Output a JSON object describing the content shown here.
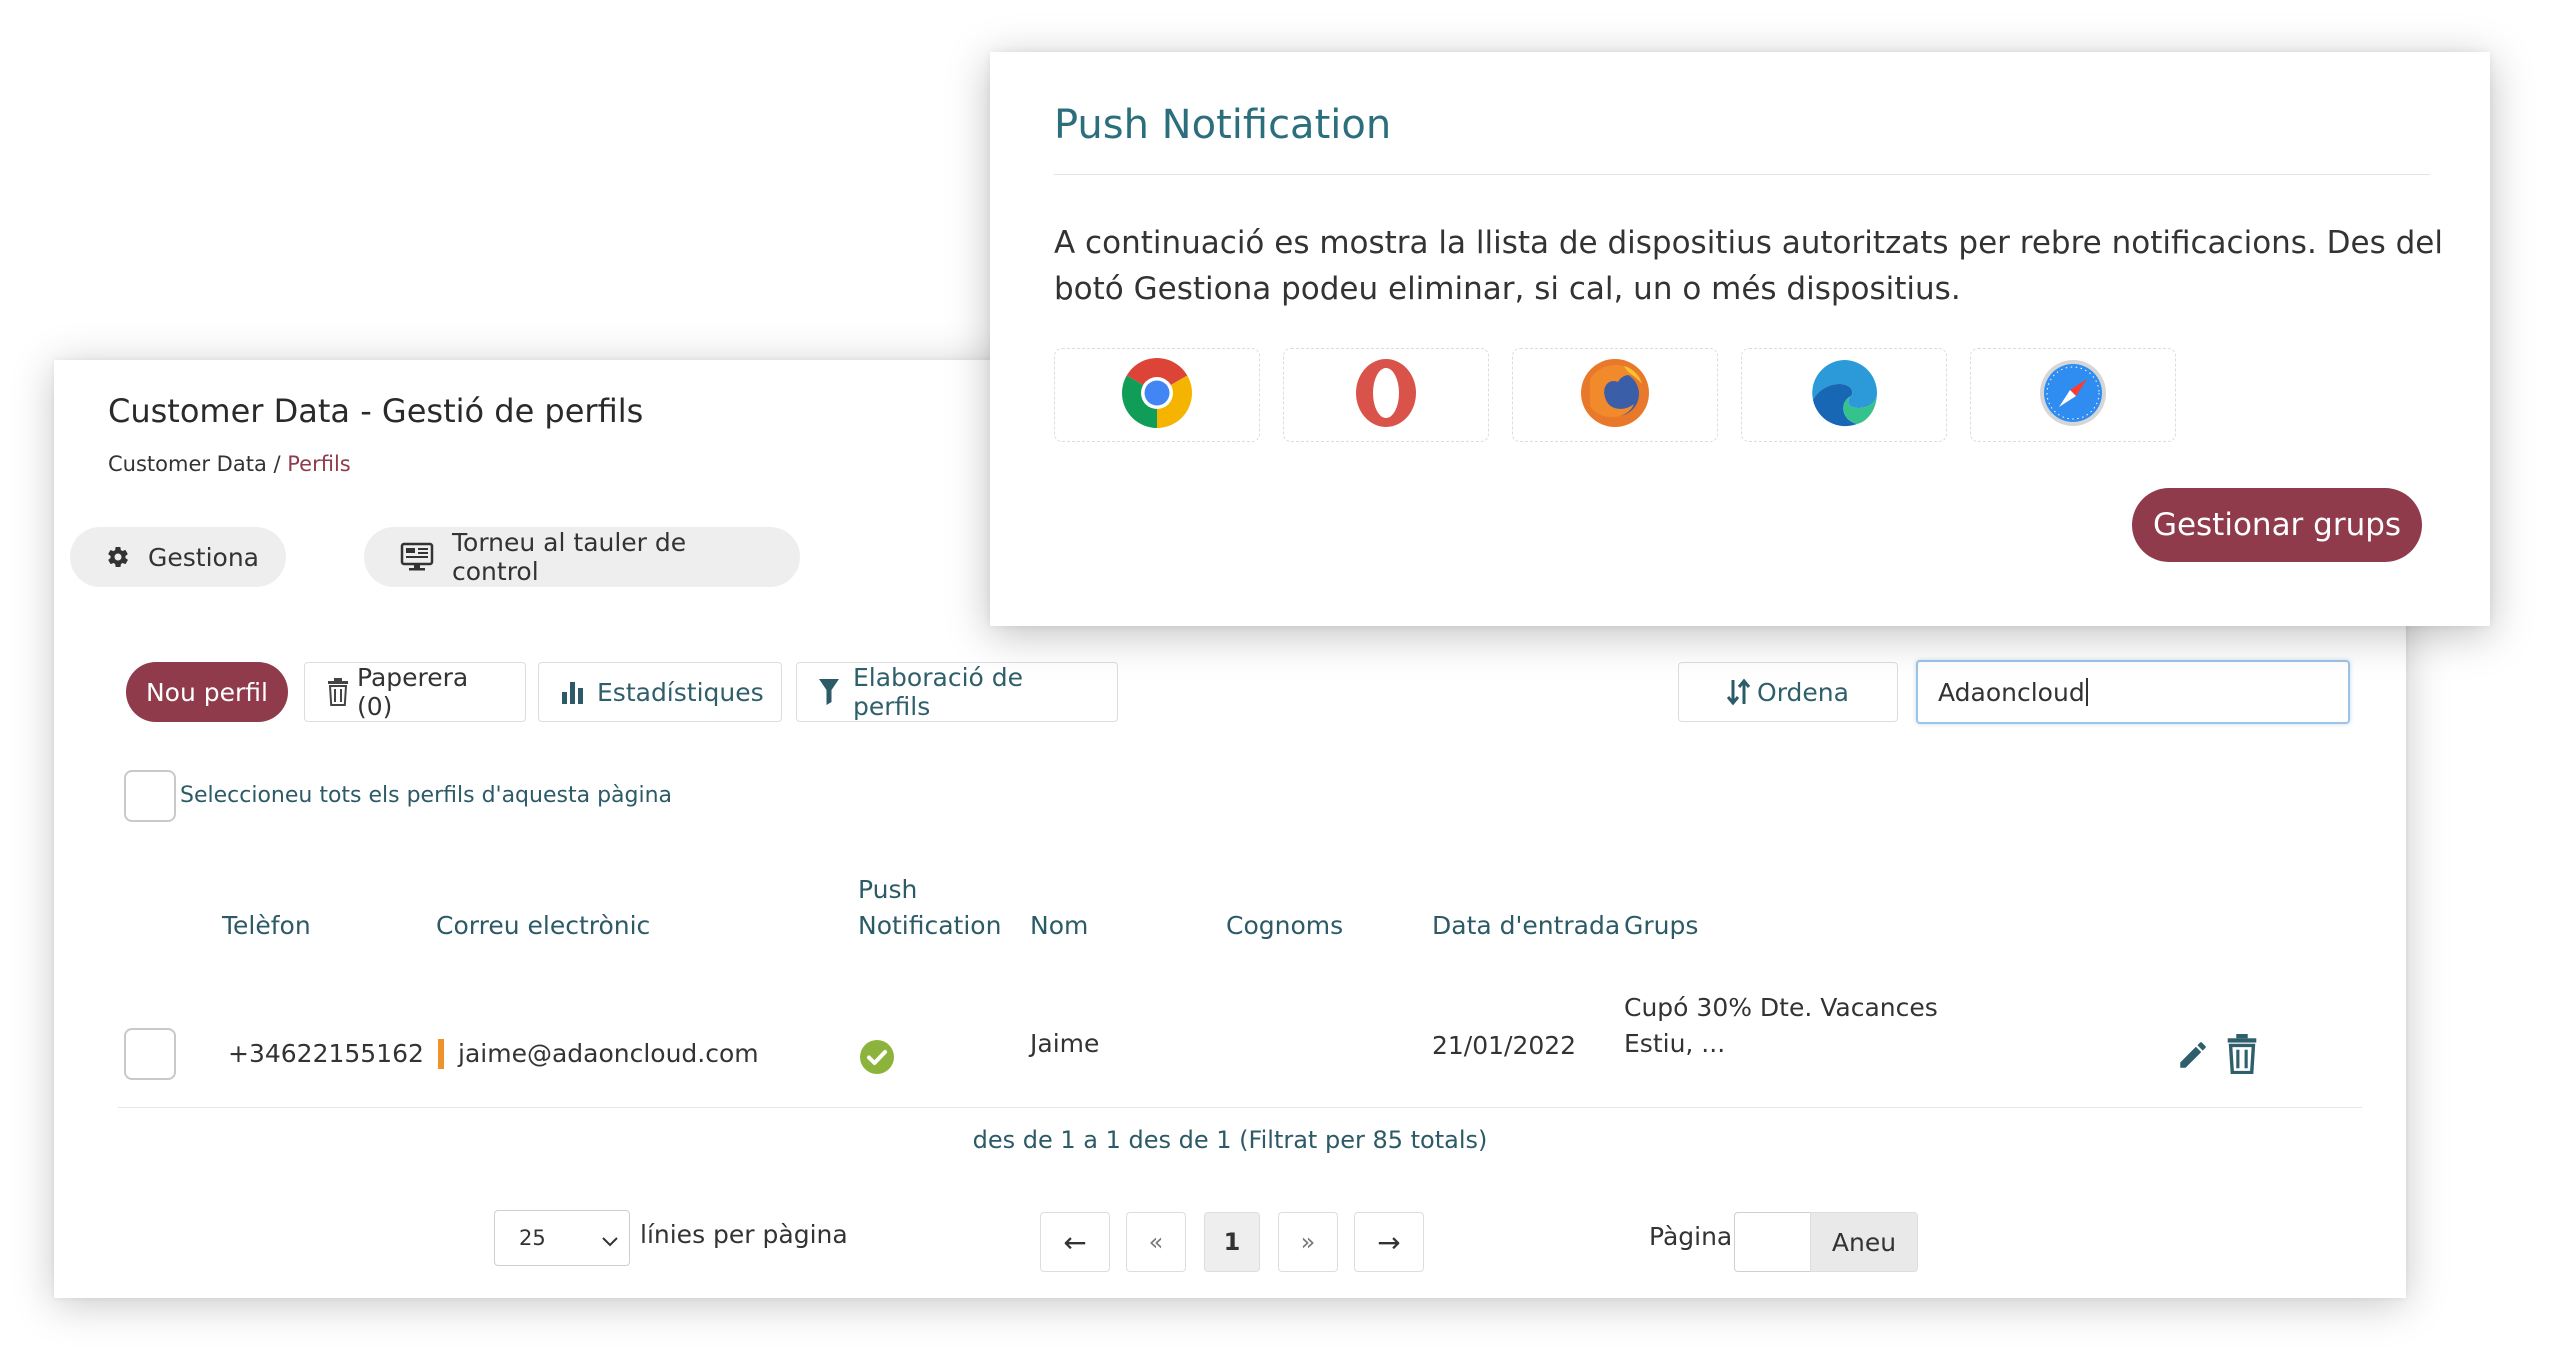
{
  "main": {
    "title": "Customer Data - Gestió de perfils",
    "breadcrumb": {
      "root": "Customer Data",
      "separator": " / ",
      "current": "Perfils"
    },
    "buttons": {
      "manage": "Gestiona",
      "back_dashboard": "Torneu al tauler de control",
      "new_profile": "Nou perfil",
      "trash": "Paperera (0)",
      "stats": "Estadístiques",
      "profiling": "Elaboració de perfils",
      "sort": "Ordena"
    },
    "search": {
      "value": "Adaoncloud"
    },
    "select_all_label": "Seleccioneu tots els perfils d'aquesta pàgina",
    "table": {
      "headers": {
        "phone": "Telèfon",
        "email": "Correu electrònic",
        "push_line1": "Push",
        "push_line2": "Notification",
        "name": "Nom",
        "surname": "Cognoms",
        "date": "Data d'entrada",
        "groups": "Grups"
      },
      "rows": [
        {
          "phone": "+34622155162",
          "email": "jaime@adaoncloud.com",
          "push": true,
          "name": "Jaime",
          "surname": "",
          "date": "21/01/2022",
          "groups_line1": "Cupó 30% Dte. Vacances",
          "groups_line2": "Estiu, ..."
        }
      ]
    },
    "summary": "des de 1 a 1 des de 1 (Filtrat per 85 totals)",
    "pagination": {
      "per_page_value": "25",
      "per_page_label": "línies per pàgina",
      "prev": "←",
      "first": "«",
      "current_page": "1",
      "last": "»",
      "next": "→",
      "page_label": "Pàgina",
      "go_button": "Aneu"
    }
  },
  "push_card": {
    "title": "Push Notification",
    "description": "A continuació es mostra la llista de dispositius autoritzats per rebre notificacions. Des del botó Gestiona podeu eliminar, si cal, un o més dispositius.",
    "browsers": [
      "chrome-icon",
      "opera-icon",
      "firefox-icon",
      "edge-icon",
      "safari-icon"
    ],
    "manage_groups_button": "Gestionar grups"
  },
  "colors": {
    "brand": "#8f3b4c",
    "link_teal": "#2c5a66",
    "title_teal": "#2c6f7c",
    "success": "#8cb43c",
    "email_marker": "#f0922b"
  }
}
